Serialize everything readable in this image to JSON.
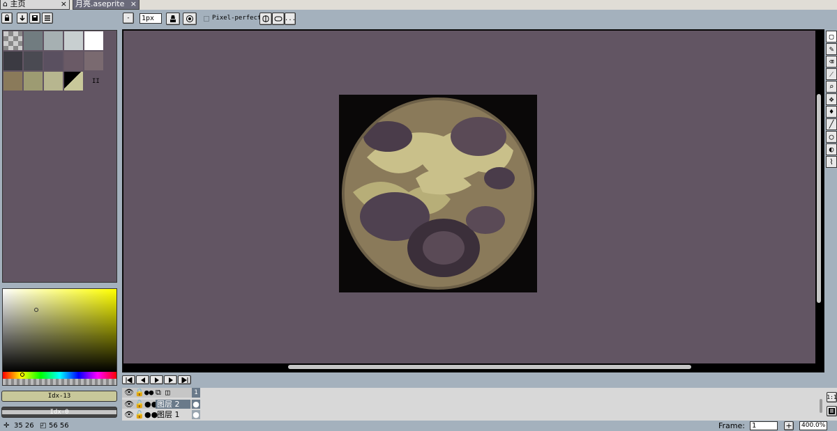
{
  "tabs": [
    {
      "label": "主页",
      "close": "×"
    },
    {
      "label": "月亮.aseprite",
      "close": "×"
    }
  ],
  "toolbar": {
    "minus": "-",
    "brush_size": "1px",
    "pixel_perfect": "Pixel-perfect",
    "more": "..."
  },
  "palette": {
    "colors": [
      "#5c616a",
      "#717c80",
      "#a6b0b2",
      "#c8cfd0",
      "#ffffff",
      "#3b3a42",
      "#4a4a52",
      "#5a5060",
      "#6a5a66",
      "#7a6a70",
      "#8a7a5a",
      "#9d9b72",
      "#b7b68f",
      "#c8c89a"
    ],
    "count_label": "II"
  },
  "color_bar": {
    "fg_label": "Idx-13",
    "fg_color": "#c8c89a",
    "bg_label": "Idx-0"
  },
  "timeline": {
    "layers": [
      {
        "name": "图层 2",
        "selected": true
      },
      {
        "name": "图层 1",
        "selected": false
      }
    ],
    "frame_number": "1"
  },
  "status": {
    "cursor": "35 26",
    "selection": "56 56",
    "frame_label": "Frame:",
    "frame_value": "1",
    "zoom": "400.0%"
  },
  "colors": {
    "canvas_bg": "#625563",
    "moon_dark": "#3b2f3a",
    "moon_light": "#c9c08a",
    "moon_mid": "#8a7a5a"
  },
  "icons": {
    "home": "home-icon",
    "eye": "eye-icon",
    "lock": "lock-icon",
    "link": "link-icon"
  }
}
